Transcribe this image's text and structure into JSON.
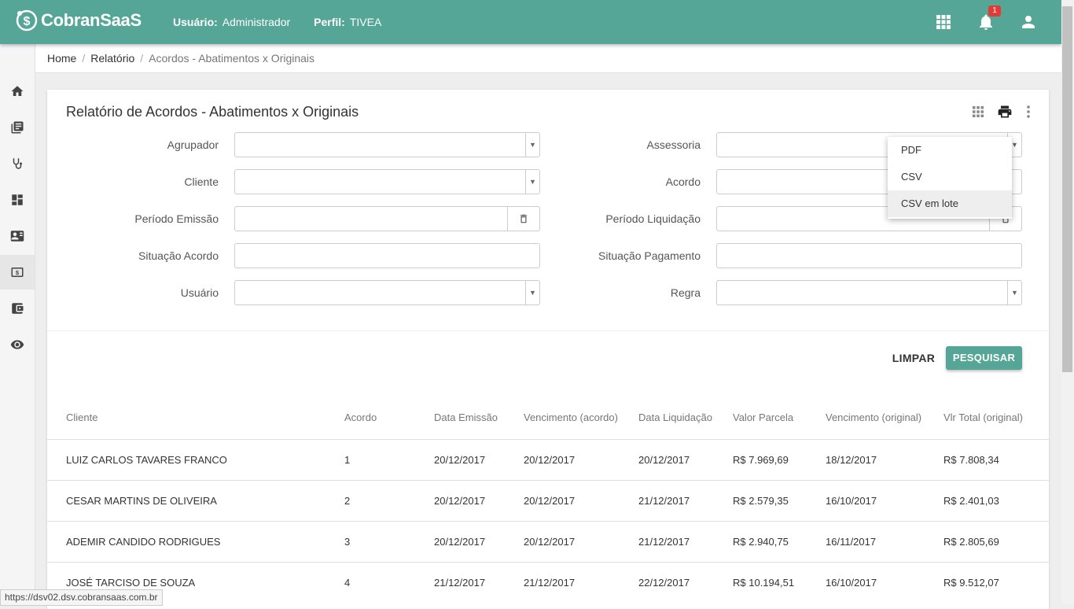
{
  "app": {
    "name": "CobranSaaS"
  },
  "header": {
    "user_label": "Usuário:",
    "user_value": "Administrador",
    "profile_label": "Perfil:",
    "profile_value": "TIVEA",
    "notifications_count": "1"
  },
  "sidebar": {
    "items": [
      "home-icon",
      "library-icon",
      "stethoscope-icon",
      "dashboard-icon",
      "contact-card-icon",
      "money-icon",
      "wallet-icon",
      "eye-icon"
    ],
    "active_index": 5
  },
  "breadcrumb": {
    "home": "Home",
    "report": "Relatório",
    "current": "Acordos - Abatimentos x Originais"
  },
  "page": {
    "title": "Relatório de Acordos - Abatimentos x Originais"
  },
  "filters": {
    "agrupador": "Agrupador",
    "cliente": "Cliente",
    "periodo_emissao": "Período Emissão",
    "situacao_acordo": "Situação Acordo",
    "usuario": "Usuário",
    "assessoria": "Assessoria",
    "acordo": "Acordo",
    "periodo_liquidacao": "Período Liquidação",
    "situacao_pagamento": "Situação Pagamento",
    "regra": "Regra"
  },
  "actions": {
    "clear": "LIMPAR",
    "search": "PESQUISAR"
  },
  "export_menu": {
    "items": [
      "PDF",
      "CSV",
      "CSV em lote"
    ],
    "hovered": "CSV em lote"
  },
  "table": {
    "headers": [
      "Cliente",
      "Acordo",
      "Data Emissão",
      "Vencimento (acordo)",
      "Data Liquidação",
      "Valor Parcela",
      "Vencimento (original)",
      "Vlr Total (original)"
    ],
    "rows": [
      [
        "LUIZ CARLOS TAVARES FRANCO",
        "1",
        "20/12/2017",
        "20/12/2017",
        "20/12/2017",
        "R$ 7.969,69",
        "18/12/2017",
        "R$ 7.808,34"
      ],
      [
        "CESAR MARTINS DE OLIVEIRA",
        "2",
        "20/12/2017",
        "20/12/2017",
        "21/12/2017",
        "R$ 2.579,35",
        "16/10/2017",
        "R$ 2.401,03"
      ],
      [
        "ADEMIR CANDIDO RODRIGUES",
        "3",
        "20/12/2017",
        "20/12/2017",
        "21/12/2017",
        "R$ 2.940,75",
        "16/11/2017",
        "R$ 2.805,69"
      ],
      [
        "JOSÉ TARCISO DE SOUZA",
        "4",
        "21/12/2017",
        "21/12/2017",
        "22/12/2017",
        "R$ 10.194,51",
        "16/10/2017",
        "R$ 9.512,07"
      ]
    ]
  },
  "status_bar": {
    "url": "https://dsv02.dsv.cobransaas.com.br"
  },
  "colors": {
    "primary": "#56a697",
    "badge": "#e53935"
  }
}
